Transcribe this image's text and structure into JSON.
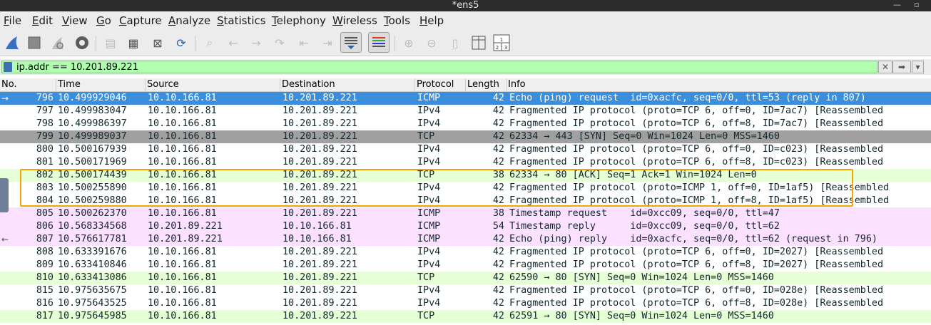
{
  "window": {
    "title": "*ens5"
  },
  "menu": [
    "File",
    "Edit",
    "View",
    "Go",
    "Capture",
    "Analyze",
    "Statistics",
    "Telephony",
    "Wireless",
    "Tools",
    "Help"
  ],
  "filter": {
    "value": "ip.addr == 10.201.89.221"
  },
  "columns": [
    "No.",
    "Time",
    "Source",
    "Destination",
    "Protocol",
    "Length",
    "Info"
  ],
  "colors": {
    "selected": "#3b8edb",
    "tcp_syn_dark": "#a0a0a0",
    "tcp": "#e7ffd4",
    "icmp": "#fce0ff",
    "ipv4": "#ffffff",
    "highlight": "#f0a500",
    "filter_ok": "#afffaf"
  },
  "packets": [
    {
      "no": "796",
      "time": "10.499929046",
      "src": "10.10.166.81",
      "dst": "10.201.89.221",
      "proto": "ICMP",
      "len": "42",
      "info": "Echo (ping) request  id=0xacfc, seq=0/0, ttl=53 (reply in 807)",
      "style": "selected",
      "mark": "→"
    },
    {
      "no": "797",
      "time": "10.499983047",
      "src": "10.10.166.81",
      "dst": "10.201.89.221",
      "proto": "IPv4",
      "len": "42",
      "info": "Fragmented IP protocol (proto=TCP 6, off=0, ID=7ac7) [Reassembled",
      "style": "ipv4",
      "mark": ""
    },
    {
      "no": "798",
      "time": "10.499986397",
      "src": "10.10.166.81",
      "dst": "10.201.89.221",
      "proto": "IPv4",
      "len": "42",
      "info": "Fragmented IP protocol (proto=TCP 6, off=8, ID=7ac7) [Reassembled",
      "style": "ipv4",
      "mark": ""
    },
    {
      "no": "799",
      "time": "10.499989037",
      "src": "10.10.166.81",
      "dst": "10.201.89.221",
      "proto": "TCP",
      "len": "42",
      "info": "62334 → 443 [SYN] Seq=0 Win=1024 Len=0 MSS=1460",
      "style": "tcp_syn_dark",
      "mark": ""
    },
    {
      "no": "800",
      "time": "10.500167939",
      "src": "10.10.166.81",
      "dst": "10.201.89.221",
      "proto": "IPv4",
      "len": "42",
      "info": "Fragmented IP protocol (proto=TCP 6, off=0, ID=c023) [Reassembled",
      "style": "ipv4",
      "mark": ""
    },
    {
      "no": "801",
      "time": "10.500171969",
      "src": "10.10.166.81",
      "dst": "10.201.89.221",
      "proto": "IPv4",
      "len": "42",
      "info": "Fragmented IP protocol (proto=TCP 6, off=8, ID=c023) [Reassembled",
      "style": "ipv4",
      "mark": ""
    },
    {
      "no": "802",
      "time": "10.500174439",
      "src": "10.10.166.81",
      "dst": "10.201.89.221",
      "proto": "TCP",
      "len": "38",
      "info": "62334 → 80 [ACK] Seq=1 Ack=1 Win=1024 Len=0",
      "style": "tcp",
      "mark": ""
    },
    {
      "no": "803",
      "time": "10.500255890",
      "src": "10.10.166.81",
      "dst": "10.201.89.221",
      "proto": "IPv4",
      "len": "42",
      "info": "Fragmented IP protocol (proto=ICMP 1, off=0, ID=1af5) [Reassembled",
      "style": "ipv4",
      "mark": ""
    },
    {
      "no": "804",
      "time": "10.500259880",
      "src": "10.10.166.81",
      "dst": "10.201.89.221",
      "proto": "IPv4",
      "len": "42",
      "info": "Fragmented IP protocol (proto=ICMP 1, off=8, ID=1af5) [Reassembled",
      "style": "ipv4",
      "mark": ""
    },
    {
      "no": "805",
      "time": "10.500262370",
      "src": "10.10.166.81",
      "dst": "10.201.89.221",
      "proto": "ICMP",
      "len": "38",
      "info": "Timestamp request    id=0xcc09, seq=0/0, ttl=47",
      "style": "icmp",
      "mark": ""
    },
    {
      "no": "806",
      "time": "10.568334568",
      "src": "10.201.89.221",
      "dst": "10.10.166.81",
      "proto": "ICMP",
      "len": "54",
      "info": "Timestamp reply      id=0xcc09, seq=0/0, ttl=62",
      "style": "icmp",
      "mark": ""
    },
    {
      "no": "807",
      "time": "10.576617781",
      "src": "10.201.89.221",
      "dst": "10.10.166.81",
      "proto": "ICMP",
      "len": "42",
      "info": "Echo (ping) reply    id=0xacfc, seq=0/0, ttl=62 (request in 796)",
      "style": "icmp",
      "mark": "←"
    },
    {
      "no": "808",
      "time": "10.633391676",
      "src": "10.10.166.81",
      "dst": "10.201.89.221",
      "proto": "IPv4",
      "len": "42",
      "info": "Fragmented IP protocol (proto=TCP 6, off=0, ID=2027) [Reassembled",
      "style": "ipv4",
      "mark": ""
    },
    {
      "no": "809",
      "time": "10.633410846",
      "src": "10.10.166.81",
      "dst": "10.201.89.221",
      "proto": "IPv4",
      "len": "42",
      "info": "Fragmented IP protocol (proto=TCP 6, off=8, ID=2027) [Reassembled",
      "style": "ipv4",
      "mark": ""
    },
    {
      "no": "810",
      "time": "10.633413086",
      "src": "10.10.166.81",
      "dst": "10.201.89.221",
      "proto": "TCP",
      "len": "42",
      "info": "62590 → 80 [SYN] Seq=0 Win=1024 Len=0 MSS=1460",
      "style": "tcp",
      "mark": ""
    },
    {
      "no": "815",
      "time": "10.975635675",
      "src": "10.10.166.81",
      "dst": "10.201.89.221",
      "proto": "IPv4",
      "len": "42",
      "info": "Fragmented IP protocol (proto=TCP 6, off=0, ID=028e) [Reassembled",
      "style": "ipv4",
      "mark": ""
    },
    {
      "no": "816",
      "time": "10.975643525",
      "src": "10.10.166.81",
      "dst": "10.201.89.221",
      "proto": "IPv4",
      "len": "42",
      "info": "Fragmented IP protocol (proto=TCP 6, off=8, ID=028e) [Reassembled",
      "style": "ipv4",
      "mark": ""
    },
    {
      "no": "817",
      "time": "10.975645985",
      "src": "10.10.166.81",
      "dst": "10.201.89.221",
      "proto": "TCP",
      "len": "42",
      "info": "62591 → 80 [SYN] Seq=0 Win=1024 Len=0 MSS=1460",
      "style": "tcp",
      "mark": ""
    }
  ]
}
